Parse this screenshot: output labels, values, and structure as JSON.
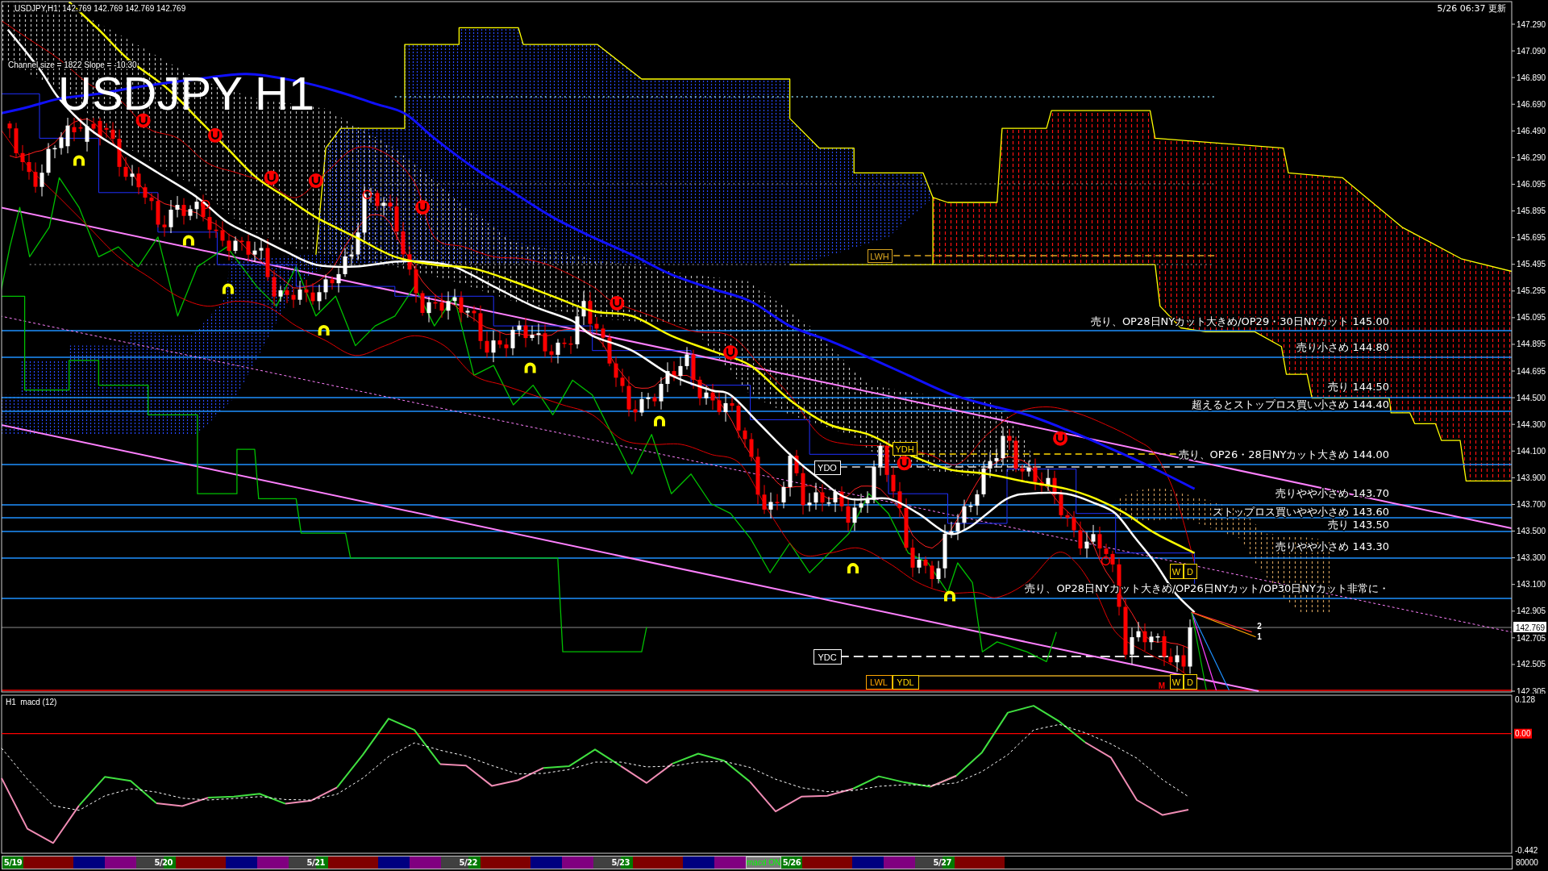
{
  "chart_header": {
    "symbol": "USDJPY,H1",
    "prices": [
      "142.769",
      "142.769",
      "142.769",
      "142.769"
    ]
  },
  "update_time": "5/26 06:37 更新",
  "channel_info": "Channel size = 1822 Slope = -10.30",
  "chart_label": "USDJPY H1",
  "level_notes": [
    "売り、OP28日NYカット大きめ/OP29・30日NYカット 145.00",
    "売り小さめ 144.80",
    "売り 144.50",
    "超えるとストップロス買い小さめ 144.40",
    "売り、OP26・28日NYカット大きめ 144.00",
    "売りやや小さめ 143.70",
    "ストップロス買いやや小さめ 143.60",
    "売り 143.50",
    "売りやや小さめ 143.30",
    "売り、OP28日NYカット大きめ/OP26日NYカット/OP30日NYカット非常に・"
  ],
  "chart_tags": [
    {
      "text": "LWH",
      "color": "#daa520",
      "kind": "boxed"
    },
    {
      "text": "YDH",
      "color": "#ffd700",
      "kind": "boxed"
    },
    {
      "text": "YDO",
      "color": "#ffffff",
      "kind": "boxed"
    },
    {
      "text": "W",
      "color": "#ffd700",
      "kind": "boxed"
    },
    {
      "text": "D",
      "color": "#ffd700",
      "kind": "boxed"
    },
    {
      "text": "2",
      "color": "#ffffff",
      "kind": "plain"
    },
    {
      "text": "1",
      "color": "#ffffff",
      "kind": "plain"
    },
    {
      "text": "YDC",
      "color": "#ffffff",
      "kind": "boxed"
    },
    {
      "text": "LWL",
      "color": "#ffa500",
      "kind": "boxed"
    },
    {
      "text": "YDL",
      "color": "#ffd700",
      "kind": "boxed"
    },
    {
      "text": "W",
      "color": "#ffd700",
      "kind": "boxed"
    },
    {
      "text": "D",
      "color": "#ffd700",
      "kind": "boxed"
    },
    {
      "text": "M",
      "color": "#ff0000",
      "kind": "plain"
    }
  ],
  "price_axis": {
    "ticks": [
      "147.290",
      "147.090",
      "146.890",
      "146.690",
      "146.490",
      "146.290",
      "146.095",
      "145.895",
      "145.695",
      "145.495",
      "145.295",
      "145.095",
      "144.895",
      "144.695",
      "144.500",
      "144.300",
      "144.100",
      "143.900",
      "143.700",
      "143.500",
      "143.300",
      "143.100",
      "142.905",
      "142.705",
      "142.505",
      "142.305"
    ],
    "current_price": "142.769"
  },
  "macd_panel": {
    "chart_data": {
      "type": "line",
      "title": "H1  macd (12)",
      "ylim": [
        -0.454,
        0.146
      ],
      "yticks": [
        {
          "value": 0.128,
          "label": "0.128"
        },
        {
          "value": -0.442,
          "label": "-0.442"
        }
      ],
      "ref_lines": [
        {
          "axis": "y",
          "value": 0,
          "label": "0.00",
          "color": "#ff0000"
        }
      ],
      "series": [
        {
          "color": "#40e040",
          "values": [
            null,
            null,
            null,
            -0.273,
            -0.164,
            -0.179,
            -0.264,
            null,
            -0.243,
            -0.239,
            -0.228,
            -0.266,
            null,
            -0.204,
            -0.08,
            0.057,
            0.014,
            -0.116,
            null,
            null,
            null,
            -0.13,
            -0.123,
            -0.06,
            -0.123,
            null,
            -0.114,
            -0.076,
            -0.103,
            -0.182,
            null,
            null,
            null,
            -0.209,
            -0.162,
            -0.185,
            -0.201,
            -0.16,
            -0.071,
            0.08,
            0.106,
            0.046,
            -0.033,
            null,
            null,
            null,
            null
          ]
        },
        {
          "color": "#f08cb4",
          "values": [
            -0.169,
            -0.361,
            -0.415,
            -0.273,
            null,
            null,
            -0.264,
            -0.275,
            -0.243,
            null,
            null,
            -0.266,
            -0.254,
            -0.204,
            null,
            null,
            null,
            -0.116,
            -0.121,
            -0.198,
            -0.177,
            -0.13,
            null,
            null,
            -0.123,
            -0.187,
            -0.114,
            null,
            null,
            -0.182,
            -0.295,
            -0.239,
            -0.236,
            -0.209,
            null,
            null,
            -0.201,
            -0.16,
            null,
            null,
            null,
            null,
            -0.033,
            -0.091,
            -0.252,
            -0.309,
            -0.289
          ]
        },
        {
          "color": "#ffffff",
          "line_style": "dashed",
          "values": [
            -0.055,
            -0.173,
            -0.273,
            -0.291,
            -0.236,
            -0.209,
            -0.222,
            -0.245,
            -0.252,
            -0.246,
            -0.239,
            -0.25,
            -0.252,
            -0.23,
            -0.169,
            -0.087,
            -0.035,
            -0.063,
            -0.085,
            -0.121,
            -0.153,
            -0.151,
            -0.136,
            -0.108,
            -0.108,
            -0.126,
            -0.123,
            -0.108,
            -0.105,
            -0.128,
            -0.173,
            -0.205,
            -0.22,
            -0.216,
            -0.2,
            -0.194,
            -0.196,
            -0.187,
            -0.144,
            -0.08,
            0.014,
            0.035,
            0.003,
            -0.039,
            -0.093,
            -0.175,
            -0.239
          ]
        }
      ]
    }
  },
  "session_bar": {
    "days": [
      {
        "date": "5/19",
        "week_start": true,
        "sessions": [
          {
            "color": "#800000"
          },
          {
            "color": "#000080"
          },
          {
            "color": "#800080"
          }
        ]
      },
      {
        "date": "5/20",
        "week_start": false,
        "sessions": [
          {
            "color": "#800000"
          },
          {
            "color": "#000080"
          },
          {
            "color": "#800080"
          }
        ]
      },
      {
        "date": "5/21",
        "week_start": false,
        "sessions": [
          {
            "color": "#800000"
          },
          {
            "color": "#000080"
          },
          {
            "color": "#800080"
          }
        ]
      },
      {
        "date": "5/22",
        "week_start": false,
        "sessions": [
          {
            "color": "#800000"
          },
          {
            "color": "#000080"
          },
          {
            "color": "#800080"
          }
        ]
      },
      {
        "date": "5/23",
        "week_start": false,
        "sessions": [
          {
            "color": "#800000"
          },
          {
            "color": "#000080"
          },
          {
            "color": "#800080"
          }
        ]
      },
      {
        "date": "5/26",
        "week_start": true,
        "sessions": [
          {
            "color": "#800000"
          },
          {
            "color": "#000080"
          },
          {
            "color": "#800080"
          }
        ]
      },
      {
        "date": "5/27",
        "week_start": false,
        "sessions": [
          {
            "color": "#800000"
          }
        ]
      }
    ],
    "toggle": {
      "label": "macd ON"
    },
    "axis_label": "80000"
  }
}
